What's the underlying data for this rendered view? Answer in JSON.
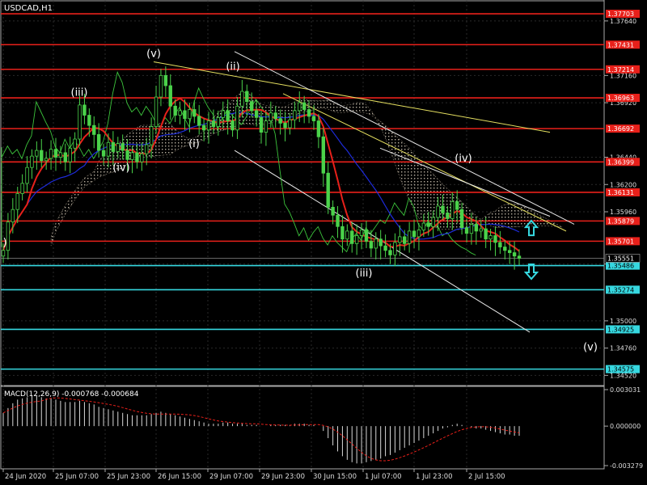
{
  "chart_data": {
    "type": "candlestick",
    "title": "USDCAD,H1",
    "x_ticks": [
      "24 Jun 2020",
      "25 Jun 07:00",
      "25 Jun 23:00",
      "26 Jun 15:00",
      "29 Jun 07:00",
      "29 Jun 23:00",
      "30 Jun 15:00",
      "1 Jul 07:00",
      "1 Jul 23:00",
      "2 Jul 15:00"
    ],
    "y_ticks": [
      "1.37640",
      "1.37160",
      "1.36920",
      "1.36440",
      "1.36200",
      "1.35960",
      "1.35500",
      "1.35000",
      "1.34760",
      "1.34520"
    ],
    "price_range": [
      1.3443,
      1.3781
    ],
    "current_price": "1.35551",
    "resistance_levels": [
      "1.37703",
      "1.37431",
      "1.37214",
      "1.36963",
      "1.36692",
      "1.36399",
      "1.36131",
      "1.35879",
      "1.35701"
    ],
    "support_levels": [
      "1.35486",
      "1.35274",
      "1.34925",
      "1.34575"
    ],
    "wave_labels": [
      "(v)",
      "(iii)",
      "(iv)",
      "(i)",
      "(ii)",
      "(iii)",
      "(iv)",
      "(v)",
      ")"
    ],
    "close_series": [
      1.3562,
      1.3587,
      1.3598,
      1.3612,
      1.3621,
      1.3635,
      1.3645,
      1.365,
      1.3641,
      1.3643,
      1.3651,
      1.3644,
      1.3648,
      1.364,
      1.3652,
      1.366,
      1.369,
      1.3681,
      1.3672,
      1.3664,
      1.365,
      1.3645,
      1.3657,
      1.3649,
      1.3656,
      1.365,
      1.3642,
      1.3648,
      1.364,
      1.3647,
      1.3655,
      1.3671,
      1.3697,
      1.3716,
      1.3707,
      1.3689,
      1.3681,
      1.3685,
      1.3678,
      1.3686,
      1.368,
      1.3672,
      1.3668,
      1.3676,
      1.3671,
      1.3679,
      1.3685,
      1.3676,
      1.3668,
      1.3689,
      1.3702,
      1.3693,
      1.3685,
      1.3679,
      1.3666,
      1.3676,
      1.3683,
      1.3678,
      1.3674,
      1.367,
      1.3677,
      1.3685,
      1.3692,
      1.3686,
      1.368,
      1.3676,
      1.3662,
      1.363,
      1.36,
      1.3593,
      1.3583,
      1.3572,
      1.3579,
      1.3568,
      1.3575,
      1.358,
      1.357,
      1.3564,
      1.3572,
      1.3566,
      1.3562,
      1.3558,
      1.3569,
      1.3574,
      1.3568,
      1.3579,
      1.3574,
      1.358,
      1.3586,
      1.3583,
      1.3591,
      1.3601,
      1.3595,
      1.359,
      1.3605,
      1.3598,
      1.3582,
      1.3577,
      1.3585,
      1.3579,
      1.3581,
      1.3572,
      1.3575,
      1.3569,
      1.3565,
      1.3562,
      1.356,
      1.3557,
      1.3555
    ],
    "macd_label": "MACD(12,26,9) -0.000768 -0.000684",
    "macd_ticks": [
      "0.003031",
      "0.000000",
      "-0.003279"
    ],
    "macd_range": [
      -0.003279,
      0.003031
    ],
    "macd_hist": [
      0.0011,
      0.0015,
      0.0019,
      0.0022,
      0.0023,
      0.0024,
      0.0025,
      0.0025,
      0.0024,
      0.0023,
      0.0023,
      0.0022,
      0.0021,
      0.002,
      0.002,
      0.002,
      0.0021,
      0.002,
      0.0019,
      0.0018,
      0.0016,
      0.0015,
      0.0014,
      0.0013,
      0.0012,
      0.0011,
      0.001,
      0.0009,
      0.0009,
      0.0009,
      0.0009,
      0.001,
      0.0011,
      0.0012,
      0.0011,
      0.001,
      0.0009,
      0.0008,
      0.0007,
      0.0006,
      0.0005,
      0.0004,
      0.0003,
      0.0002,
      0.0002,
      0.0002,
      0.0003,
      0.0003,
      0.0002,
      0.0002,
      0.0002,
      0.0001,
      0.0001,
      0.0001,
      0.0,
      0.0,
      0.0001,
      0.0001,
      0.0001,
      0.0001,
      0.0001,
      0.0002,
      0.0002,
      0.0002,
      0.0001,
      0.0001,
      0.0,
      -0.0004,
      -0.001,
      -0.0016,
      -0.0021,
      -0.0025,
      -0.0028,
      -0.003,
      -0.0031,
      -0.0031,
      -0.003,
      -0.0029,
      -0.0028,
      -0.0027,
      -0.0025,
      -0.0024,
      -0.0022,
      -0.002,
      -0.0018,
      -0.0016,
      -0.0014,
      -0.0012,
      -0.001,
      -0.0008,
      -0.0006,
      -0.0004,
      -0.0002,
      -0.0001,
      0.0001,
      0.0002,
      0.0001,
      0.0,
      -0.0001,
      -0.0002,
      -0.0002,
      -0.0003,
      -0.0004,
      -0.0005,
      -0.0006,
      -0.0007,
      -0.0007,
      -0.0008,
      -0.0008
    ]
  }
}
